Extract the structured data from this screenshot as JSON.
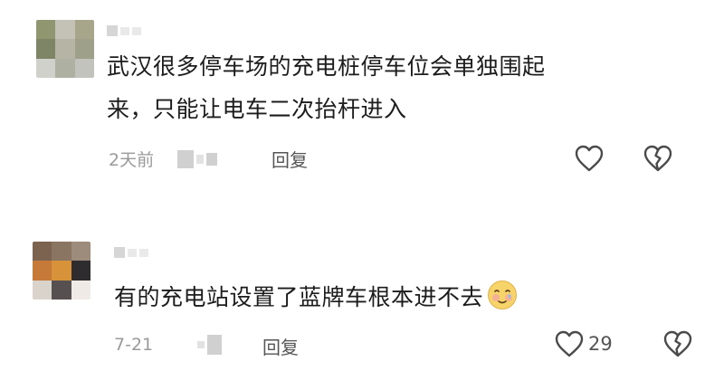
{
  "comments": [
    {
      "text_line1": "武汉很多停车场的充电桩停车位会单独围起",
      "text_line2": "来，只能让电车二次抬杆进入",
      "time": "2天前",
      "reply_label": "回复",
      "like_count": ""
    },
    {
      "text_line1": "有的充电站设置了蓝牌车根本进不去",
      "emoji": "smiling-face-with-tear-emoji",
      "time": "7-21",
      "reply_label": "回复",
      "like_count": "29"
    }
  ],
  "colors": {
    "text": "#1c1c1c",
    "meta": "#9a9a9a",
    "icon_stroke": "#4a4a4a"
  }
}
